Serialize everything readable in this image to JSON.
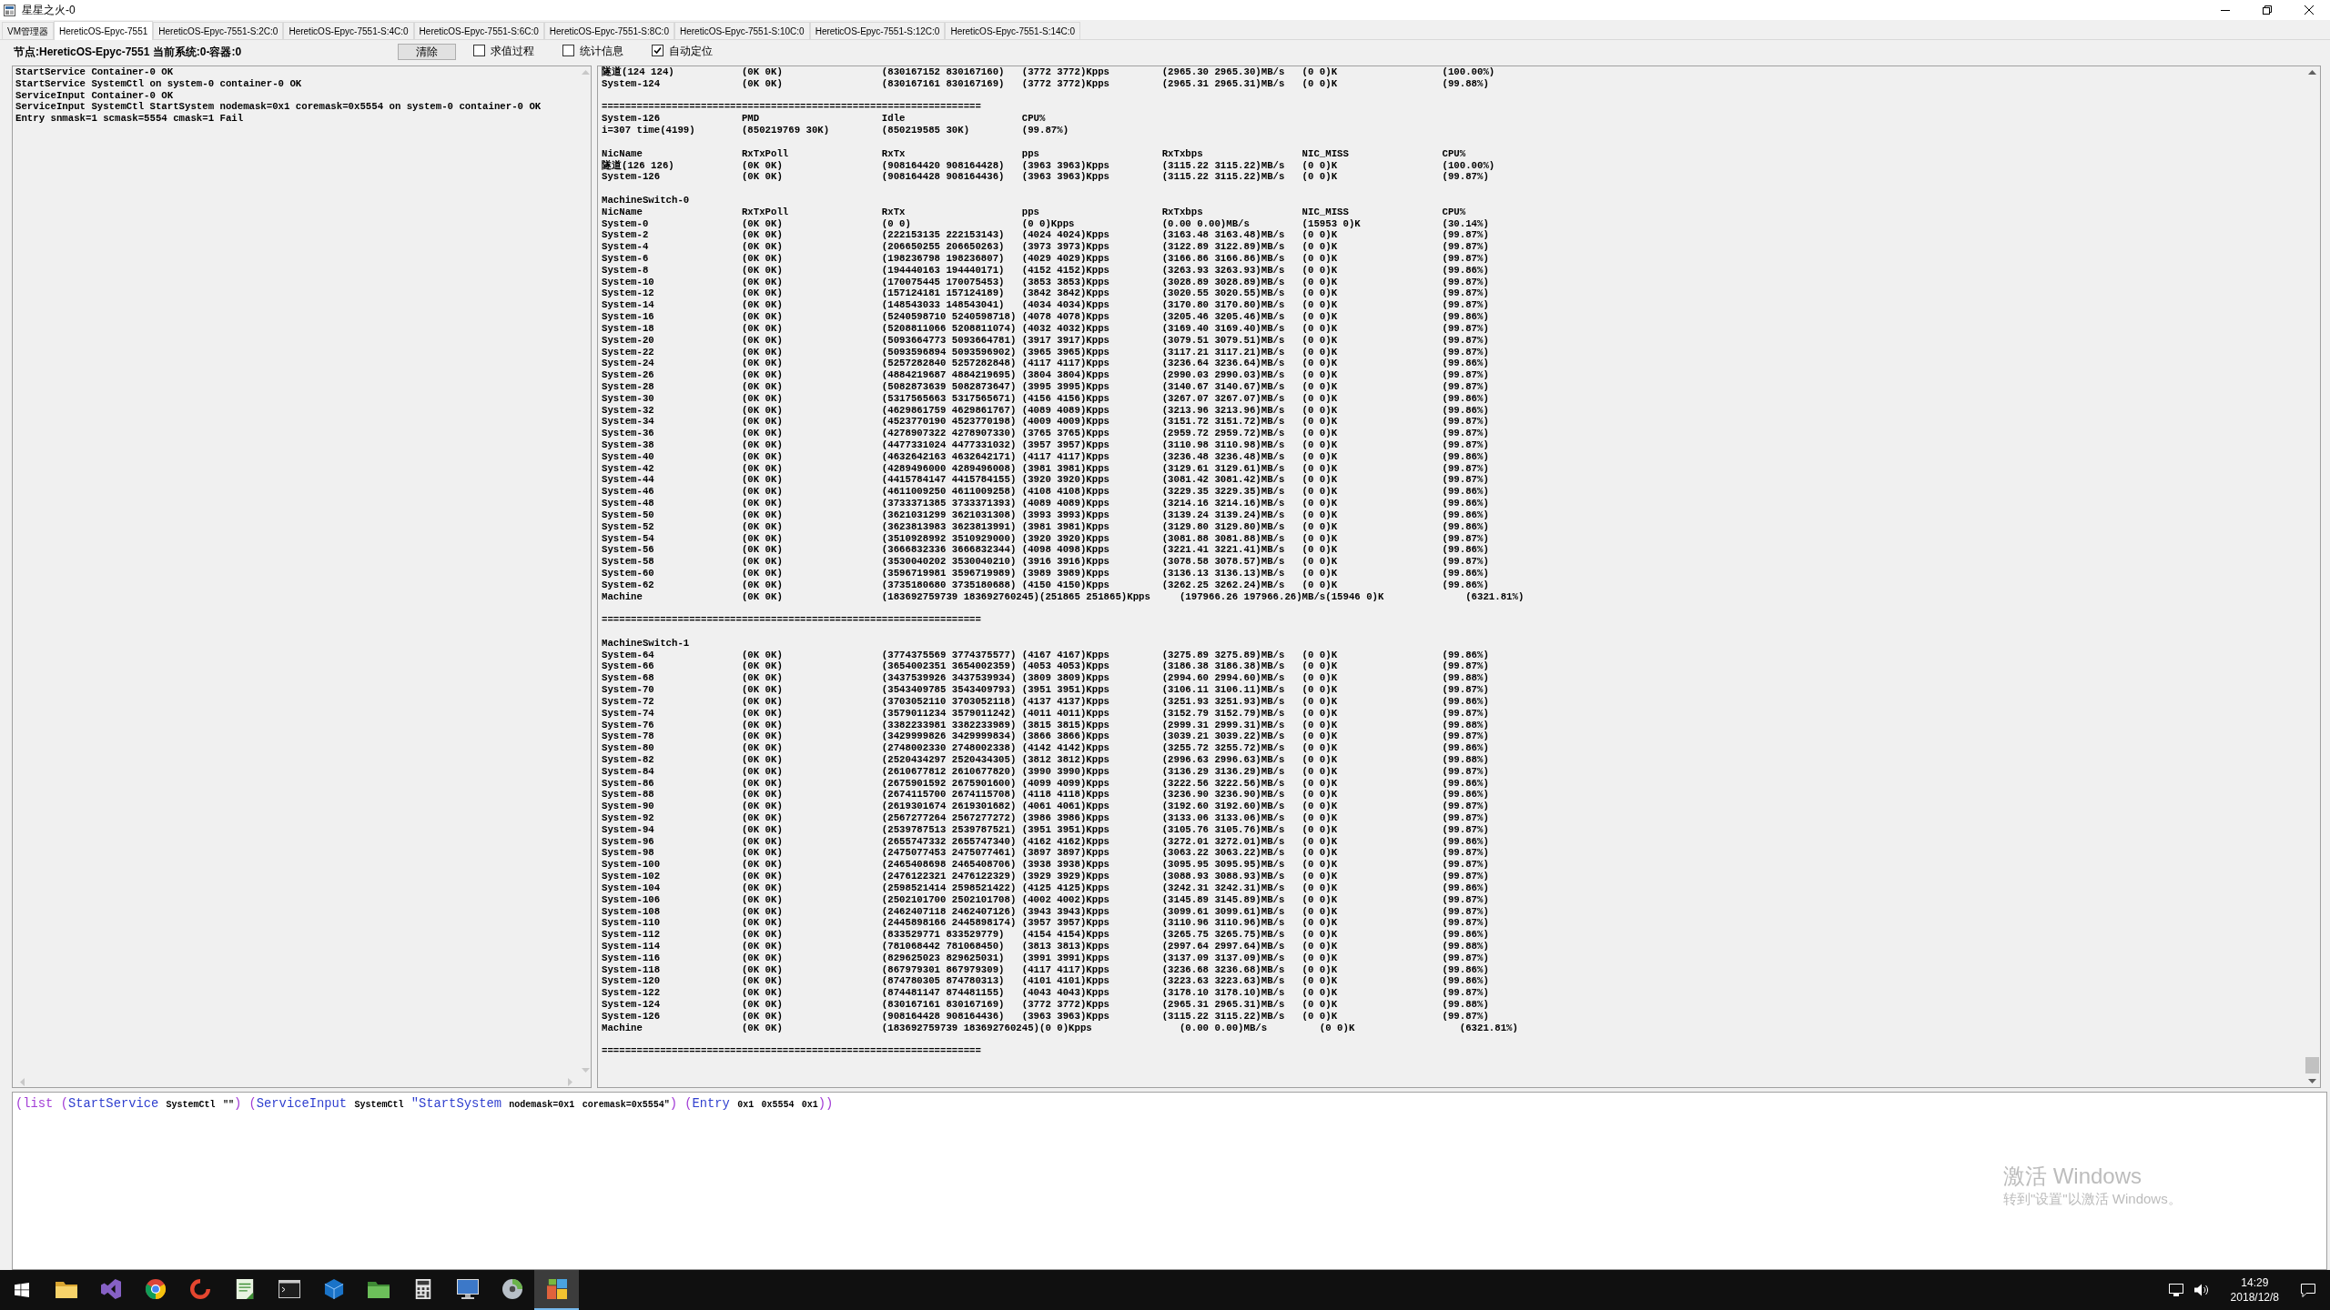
{
  "window": {
    "title": "星星之火-0"
  },
  "tabs": [
    {
      "label": "VM管理器",
      "selected": false
    },
    {
      "label": "HereticOS-Epyc-7551",
      "selected": true
    },
    {
      "label": "HereticOS-Epyc-7551-S:2C:0",
      "selected": false
    },
    {
      "label": "HereticOS-Epyc-7551-S:4C:0",
      "selected": false
    },
    {
      "label": "HereticOS-Epyc-7551-S:6C:0",
      "selected": false
    },
    {
      "label": "HereticOS-Epyc-7551-S:8C:0",
      "selected": false
    },
    {
      "label": "HereticOS-Epyc-7551-S:10C:0",
      "selected": false
    },
    {
      "label": "HereticOS-Epyc-7551-S:12C:0",
      "selected": false
    },
    {
      "label": "HereticOS-Epyc-7551-S:14C:0",
      "selected": false
    }
  ],
  "toolbar": {
    "node_label": "节点:HereticOS-Epyc-7551 当前系统:0-容器:0",
    "clear_button": "清除",
    "checkboxes": [
      {
        "label": "求值过程",
        "checked": false
      },
      {
        "label": "统计信息",
        "checked": false
      },
      {
        "label": "自动定位",
        "checked": true
      }
    ]
  },
  "log_panel": {
    "lines": [
      "StartService Container-0 OK",
      "StartService SystemCtl on system-0 container-0 OK",
      "ServiceInput Container-0 OK",
      "ServiceInput SystemCtl StartSystem nodemask=0x1 coremask=0x5554 on system-0 container-0 OK",
      "Entry snmask=1 scmask=5554 cmask=1 Fail"
    ]
  },
  "stats_panel": {
    "lines": [
      {
        "kind": "row",
        "cells": [
          "隧道(124 124)",
          "(0K 0K)",
          "(830167152 830167160)",
          "(3772 3772)Kpps",
          "(2965.30 2965.30)MB/s",
          "(0 0)K",
          "(100.00%)"
        ]
      },
      {
        "kind": "row",
        "cells": [
          "System-124",
          "(0K 0K)",
          "(830167161 830167169)",
          "(3772 3772)Kpps",
          "(2965.31 2965.31)MB/s",
          "(0 0)K",
          "(99.88%)"
        ]
      },
      {
        "kind": "blank"
      },
      {
        "kind": "separator",
        "text": "================================================================="
      },
      {
        "kind": "row",
        "cells": [
          "System-126",
          "PMD",
          "Idle",
          "CPU%"
        ]
      },
      {
        "kind": "row",
        "cells": [
          "i=307 time(4199)",
          "(850219769 30K)",
          "(850219585 30K)",
          "(99.87%)"
        ]
      },
      {
        "kind": "blank"
      },
      {
        "kind": "row",
        "cells": [
          "NicName",
          "RxTxPoll",
          "RxTx",
          "pps",
          "RxTxbps",
          "NIC_MISS",
          "CPU%"
        ]
      },
      {
        "kind": "row",
        "cells": [
          "隧道(126 126)",
          "(0K 0K)",
          "(908164420 908164428)",
          "(3963 3963)Kpps",
          "(3115.22 3115.22)MB/s",
          "(0 0)K",
          "(100.00%)"
        ]
      },
      {
        "kind": "row",
        "cells": [
          "System-126",
          "(0K 0K)",
          "(908164428 908164436)",
          "(3963 3963)Kpps",
          "(3115.22 3115.22)MB/s",
          "(0 0)K",
          "(99.87%)"
        ]
      },
      {
        "kind": "blank"
      },
      {
        "kind": "row",
        "cells": [
          "MachineSwitch-0"
        ]
      },
      {
        "kind": "row",
        "cells": [
          "NicName",
          "RxTxPoll",
          "RxTx",
          "pps",
          "RxTxbps",
          "NIC_MISS",
          "CPU%"
        ]
      },
      {
        "kind": "row",
        "cells": [
          "System-0",
          "(0K 0K)",
          "(0 0)",
          "(0 0)Kpps",
          "(0.00 0.00)MB/s",
          "(15953 0)K",
          "(30.14%)"
        ]
      },
      {
        "kind": "row",
        "cells": [
          "System-2",
          "(0K 0K)",
          "(222153135 222153143)",
          "(4024 4024)Kpps",
          "(3163.48 3163.48)MB/s",
          "(0 0)K",
          "(99.87%)"
        ]
      },
      {
        "kind": "row",
        "cells": [
          "System-4",
          "(0K 0K)",
          "(206650255 206650263)",
          "(3973 3973)Kpps",
          "(3122.89 3122.89)MB/s",
          "(0 0)K",
          "(99.87%)"
        ]
      },
      {
        "kind": "row",
        "cells": [
          "System-6",
          "(0K 0K)",
          "(198236798 198236807)",
          "(4029 4029)Kpps",
          "(3166.86 3166.86)MB/s",
          "(0 0)K",
          "(99.87%)"
        ]
      },
      {
        "kind": "row",
        "cells": [
          "System-8",
          "(0K 0K)",
          "(194440163 194440171)",
          "(4152 4152)Kpps",
          "(3263.93 3263.93)MB/s",
          "(0 0)K",
          "(99.86%)"
        ]
      },
      {
        "kind": "row",
        "cells": [
          "System-10",
          "(0K 0K)",
          "(170075445 170075453)",
          "(3853 3853)Kpps",
          "(3028.89 3028.89)MB/s",
          "(0 0)K",
          "(99.87%)"
        ]
      },
      {
        "kind": "row",
        "cells": [
          "System-12",
          "(0K 0K)",
          "(157124181 157124189)",
          "(3842 3842)Kpps",
          "(3020.55 3020.55)MB/s",
          "(0 0)K",
          "(99.87%)"
        ]
      },
      {
        "kind": "row",
        "cells": [
          "System-14",
          "(0K 0K)",
          "(148543033 148543041)",
          "(4034 4034)Kpps",
          "(3170.80 3170.80)MB/s",
          "(0 0)K",
          "(99.87%)"
        ]
      },
      {
        "kind": "row",
        "cells": [
          "System-16",
          "(0K 0K)",
          "(5240598710 5240598718)",
          "(4078 4078)Kpps",
          "(3205.46 3205.46)MB/s",
          "(0 0)K",
          "(99.86%)"
        ]
      },
      {
        "kind": "row",
        "cells": [
          "System-18",
          "(0K 0K)",
          "(5208811066 5208811074)",
          "(4032 4032)Kpps",
          "(3169.40 3169.40)MB/s",
          "(0 0)K",
          "(99.87%)"
        ]
      },
      {
        "kind": "row",
        "cells": [
          "System-20",
          "(0K 0K)",
          "(5093664773 5093664781)",
          "(3917 3917)Kpps",
          "(3079.51 3079.51)MB/s",
          "(0 0)K",
          "(99.87%)"
        ]
      },
      {
        "kind": "row",
        "cells": [
          "System-22",
          "(0K 0K)",
          "(5093596894 5093596902)",
          "(3965 3965)Kpps",
          "(3117.21 3117.21)MB/s",
          "(0 0)K",
          "(99.87%)"
        ]
      },
      {
        "kind": "row",
        "cells": [
          "System-24",
          "(0K 0K)",
          "(5257282840 5257282848)",
          "(4117 4117)Kpps",
          "(3236.64 3236.64)MB/s",
          "(0 0)K",
          "(99.86%)"
        ]
      },
      {
        "kind": "row",
        "cells": [
          "System-26",
          "(0K 0K)",
          "(4884219687 4884219695)",
          "(3804 3804)Kpps",
          "(2990.03 2990.03)MB/s",
          "(0 0)K",
          "(99.87%)"
        ]
      },
      {
        "kind": "row",
        "cells": [
          "System-28",
          "(0K 0K)",
          "(5082873639 5082873647)",
          "(3995 3995)Kpps",
          "(3140.67 3140.67)MB/s",
          "(0 0)K",
          "(99.87%)"
        ]
      },
      {
        "kind": "row",
        "cells": [
          "System-30",
          "(0K 0K)",
          "(5317565663 5317565671)",
          "(4156 4156)Kpps",
          "(3267.07 3267.07)MB/s",
          "(0 0)K",
          "(99.86%)"
        ]
      },
      {
        "kind": "row",
        "cells": [
          "System-32",
          "(0K 0K)",
          "(4629861759 4629861767)",
          "(4089 4089)Kpps",
          "(3213.96 3213.96)MB/s",
          "(0 0)K",
          "(99.86%)"
        ]
      },
      {
        "kind": "row",
        "cells": [
          "System-34",
          "(0K 0K)",
          "(4523770190 4523770198)",
          "(4009 4009)Kpps",
          "(3151.72 3151.72)MB/s",
          "(0 0)K",
          "(99.87%)"
        ]
      },
      {
        "kind": "row",
        "cells": [
          "System-36",
          "(0K 0K)",
          "(4278907322 4278907330)",
          "(3765 3765)Kpps",
          "(2959.72 2959.72)MB/s",
          "(0 0)K",
          "(99.87%)"
        ]
      },
      {
        "kind": "row",
        "cells": [
          "System-38",
          "(0K 0K)",
          "(4477331024 4477331032)",
          "(3957 3957)Kpps",
          "(3110.98 3110.98)MB/s",
          "(0 0)K",
          "(99.87%)"
        ]
      },
      {
        "kind": "row",
        "cells": [
          "System-40",
          "(0K 0K)",
          "(4632642163 4632642171)",
          "(4117 4117)Kpps",
          "(3236.48 3236.48)MB/s",
          "(0 0)K",
          "(99.86%)"
        ]
      },
      {
        "kind": "row",
        "cells": [
          "System-42",
          "(0K 0K)",
          "(4289496000 4289496008)",
          "(3981 3981)Kpps",
          "(3129.61 3129.61)MB/s",
          "(0 0)K",
          "(99.87%)"
        ]
      },
      {
        "kind": "row",
        "cells": [
          "System-44",
          "(0K 0K)",
          "(4415784147 4415784155)",
          "(3920 3920)Kpps",
          "(3081.42 3081.42)MB/s",
          "(0 0)K",
          "(99.87%)"
        ]
      },
      {
        "kind": "row",
        "cells": [
          "System-46",
          "(0K 0K)",
          "(4611009250 4611009258)",
          "(4108 4108)Kpps",
          "(3229.35 3229.35)MB/s",
          "(0 0)K",
          "(99.86%)"
        ]
      },
      {
        "kind": "row",
        "cells": [
          "System-48",
          "(0K 0K)",
          "(3733371385 3733371393)",
          "(4089 4089)Kpps",
          "(3214.16 3214.16)MB/s",
          "(0 0)K",
          "(99.86%)"
        ]
      },
      {
        "kind": "row",
        "cells": [
          "System-50",
          "(0K 0K)",
          "(3621031299 3621031308)",
          "(3993 3993)Kpps",
          "(3139.24 3139.24)MB/s",
          "(0 0)K",
          "(99.86%)"
        ]
      },
      {
        "kind": "row",
        "cells": [
          "System-52",
          "(0K 0K)",
          "(3623813983 3623813991)",
          "(3981 3981)Kpps",
          "(3129.80 3129.80)MB/s",
          "(0 0)K",
          "(99.86%)"
        ]
      },
      {
        "kind": "row",
        "cells": [
          "System-54",
          "(0K 0K)",
          "(3510928992 3510929000)",
          "(3920 3920)Kpps",
          "(3081.88 3081.88)MB/s",
          "(0 0)K",
          "(99.87%)"
        ]
      },
      {
        "kind": "row",
        "cells": [
          "System-56",
          "(0K 0K)",
          "(3666832336 3666832344)",
          "(4098 4098)Kpps",
          "(3221.41 3221.41)MB/s",
          "(0 0)K",
          "(99.86%)"
        ]
      },
      {
        "kind": "row",
        "cells": [
          "System-58",
          "(0K 0K)",
          "(3530040202 3530040210)",
          "(3916 3916)Kpps",
          "(3078.58 3078.57)MB/s",
          "(0 0)K",
          "(99.87%)"
        ]
      },
      {
        "kind": "row",
        "cells": [
          "System-60",
          "(0K 0K)",
          "(3596719981 3596719989)",
          "(3989 3989)Kpps",
          "(3136.13 3136.13)MB/s",
          "(0 0)K",
          "(99.86%)"
        ]
      },
      {
        "kind": "row",
        "cells": [
          "System-62",
          "(0K 0K)",
          "(3735180680 3735180688)",
          "(4150 4150)Kpps",
          "(3262.25 3262.24)MB/s",
          "(0 0)K",
          "(99.86%)"
        ]
      },
      {
        "kind": "row",
        "cells": [
          "Machine",
          "(0K 0K)",
          "(183692759739 183692760245)",
          "(251865 251865)Kpps",
          "(197966.26 197966.26)MB/s",
          "(15946 0)K",
          "(6321.81%)"
        ]
      },
      {
        "kind": "blank"
      },
      {
        "kind": "separator",
        "text": "================================================================="
      },
      {
        "kind": "blank"
      },
      {
        "kind": "row",
        "cells": [
          "MachineSwitch-1"
        ]
      },
      {
        "kind": "row",
        "cells": [
          "System-64",
          "(0K 0K)",
          "(3774375569 3774375577)",
          "(4167 4167)Kpps",
          "(3275.89 3275.89)MB/s",
          "(0 0)K",
          "(99.86%)"
        ]
      },
      {
        "kind": "row",
        "cells": [
          "System-66",
          "(0K 0K)",
          "(3654002351 3654002359)",
          "(4053 4053)Kpps",
          "(3186.38 3186.38)MB/s",
          "(0 0)K",
          "(99.87%)"
        ]
      },
      {
        "kind": "row",
        "cells": [
          "System-68",
          "(0K 0K)",
          "(3437539926 3437539934)",
          "(3809 3809)Kpps",
          "(2994.60 2994.60)MB/s",
          "(0 0)K",
          "(99.88%)"
        ]
      },
      {
        "kind": "row",
        "cells": [
          "System-70",
          "(0K 0K)",
          "(3543409785 3543409793)",
          "(3951 3951)Kpps",
          "(3106.11 3106.11)MB/s",
          "(0 0)K",
          "(99.87%)"
        ]
      },
      {
        "kind": "row",
        "cells": [
          "System-72",
          "(0K 0K)",
          "(3703052110 3703052118)",
          "(4137 4137)Kpps",
          "(3251.93 3251.93)MB/s",
          "(0 0)K",
          "(99.86%)"
        ]
      },
      {
        "kind": "row",
        "cells": [
          "System-74",
          "(0K 0K)",
          "(3579011234 3579011242)",
          "(4011 4011)Kpps",
          "(3152.79 3152.79)MB/s",
          "(0 0)K",
          "(99.87%)"
        ]
      },
      {
        "kind": "row",
        "cells": [
          "System-76",
          "(0K 0K)",
          "(3382233981 3382233989)",
          "(3815 3815)Kpps",
          "(2999.31 2999.31)MB/s",
          "(0 0)K",
          "(99.88%)"
        ]
      },
      {
        "kind": "row",
        "cells": [
          "System-78",
          "(0K 0K)",
          "(3429999826 3429999834)",
          "(3866 3866)Kpps",
          "(3039.21 3039.22)MB/s",
          "(0 0)K",
          "(99.87%)"
        ]
      },
      {
        "kind": "row",
        "cells": [
          "System-80",
          "(0K 0K)",
          "(2748002330 2748002338)",
          "(4142 4142)Kpps",
          "(3255.72 3255.72)MB/s",
          "(0 0)K",
          "(99.86%)"
        ]
      },
      {
        "kind": "row",
        "cells": [
          "System-82",
          "(0K 0K)",
          "(2520434297 2520434305)",
          "(3812 3812)Kpps",
          "(2996.63 2996.63)MB/s",
          "(0 0)K",
          "(99.88%)"
        ]
      },
      {
        "kind": "row",
        "cells": [
          "System-84",
          "(0K 0K)",
          "(2610677812 2610677820)",
          "(3990 3990)Kpps",
          "(3136.29 3136.29)MB/s",
          "(0 0)K",
          "(99.87%)"
        ]
      },
      {
        "kind": "row",
        "cells": [
          "System-86",
          "(0K 0K)",
          "(2675901592 2675901600)",
          "(4099 4099)Kpps",
          "(3222.56 3222.56)MB/s",
          "(0 0)K",
          "(99.86%)"
        ]
      },
      {
        "kind": "row",
        "cells": [
          "System-88",
          "(0K 0K)",
          "(2674115700 2674115708)",
          "(4118 4118)Kpps",
          "(3236.90 3236.90)MB/s",
          "(0 0)K",
          "(99.86%)"
        ]
      },
      {
        "kind": "row",
        "cells": [
          "System-90",
          "(0K 0K)",
          "(2619301674 2619301682)",
          "(4061 4061)Kpps",
          "(3192.60 3192.60)MB/s",
          "(0 0)K",
          "(99.87%)"
        ]
      },
      {
        "kind": "row",
        "cells": [
          "System-92",
          "(0K 0K)",
          "(2567277264 2567277272)",
          "(3986 3986)Kpps",
          "(3133.06 3133.06)MB/s",
          "(0 0)K",
          "(99.87%)"
        ]
      },
      {
        "kind": "row",
        "cells": [
          "System-94",
          "(0K 0K)",
          "(2539787513 2539787521)",
          "(3951 3951)Kpps",
          "(3105.76 3105.76)MB/s",
          "(0 0)K",
          "(99.87%)"
        ]
      },
      {
        "kind": "row",
        "cells": [
          "System-96",
          "(0K 0K)",
          "(2655747332 2655747340)",
          "(4162 4162)Kpps",
          "(3272.01 3272.01)MB/s",
          "(0 0)K",
          "(99.86%)"
        ]
      },
      {
        "kind": "row",
        "cells": [
          "System-98",
          "(0K 0K)",
          "(2475077453 2475077461)",
          "(3897 3897)Kpps",
          "(3063.22 3063.22)MB/s",
          "(0 0)K",
          "(99.87%)"
        ]
      },
      {
        "kind": "row",
        "cells": [
          "System-100",
          "(0K 0K)",
          "(2465408698 2465408706)",
          "(3938 3938)Kpps",
          "(3095.95 3095.95)MB/s",
          "(0 0)K",
          "(99.87%)"
        ]
      },
      {
        "kind": "row",
        "cells": [
          "System-102",
          "(0K 0K)",
          "(2476122321 2476122329)",
          "(3929 3929)Kpps",
          "(3088.93 3088.93)MB/s",
          "(0 0)K",
          "(99.87%)"
        ]
      },
      {
        "kind": "row",
        "cells": [
          "System-104",
          "(0K 0K)",
          "(2598521414 2598521422)",
          "(4125 4125)Kpps",
          "(3242.31 3242.31)MB/s",
          "(0 0)K",
          "(99.86%)"
        ]
      },
      {
        "kind": "row",
        "cells": [
          "System-106",
          "(0K 0K)",
          "(2502101700 2502101708)",
          "(4002 4002)Kpps",
          "(3145.89 3145.89)MB/s",
          "(0 0)K",
          "(99.87%)"
        ]
      },
      {
        "kind": "row",
        "cells": [
          "System-108",
          "(0K 0K)",
          "(2462407118 2462407126)",
          "(3943 3943)Kpps",
          "(3099.61 3099.61)MB/s",
          "(0 0)K",
          "(99.87%)"
        ]
      },
      {
        "kind": "row",
        "cells": [
          "System-110",
          "(0K 0K)",
          "(2445898166 2445898174)",
          "(3957 3957)Kpps",
          "(3110.96 3110.96)MB/s",
          "(0 0)K",
          "(99.87%)"
        ]
      },
      {
        "kind": "row",
        "cells": [
          "System-112",
          "(0K 0K)",
          "(833529771 833529779)",
          "(4154 4154)Kpps",
          "(3265.75 3265.75)MB/s",
          "(0 0)K",
          "(99.86%)"
        ]
      },
      {
        "kind": "row",
        "cells": [
          "System-114",
          "(0K 0K)",
          "(781068442 781068450)",
          "(3813 3813)Kpps",
          "(2997.64 2997.64)MB/s",
          "(0 0)K",
          "(99.88%)"
        ]
      },
      {
        "kind": "row",
        "cells": [
          "System-116",
          "(0K 0K)",
          "(829625023 829625031)",
          "(3991 3991)Kpps",
          "(3137.09 3137.09)MB/s",
          "(0 0)K",
          "(99.87%)"
        ]
      },
      {
        "kind": "row",
        "cells": [
          "System-118",
          "(0K 0K)",
          "(867979301 867979309)",
          "(4117 4117)Kpps",
          "(3236.68 3236.68)MB/s",
          "(0 0)K",
          "(99.86%)"
        ]
      },
      {
        "kind": "row",
        "cells": [
          "System-120",
          "(0K 0K)",
          "(874780305 874780313)",
          "(4101 4101)Kpps",
          "(3223.63 3223.63)MB/s",
          "(0 0)K",
          "(99.86%)"
        ]
      },
      {
        "kind": "row",
        "cells": [
          "System-122",
          "(0K 0K)",
          "(874481147 874481155)",
          "(4043 4043)Kpps",
          "(3178.10 3178.10)MB/s",
          "(0 0)K",
          "(99.87%)"
        ]
      },
      {
        "kind": "row",
        "cells": [
          "System-124",
          "(0K 0K)",
          "(830167161 830167169)",
          "(3772 3772)Kpps",
          "(2965.31 2965.31)MB/s",
          "(0 0)K",
          "(99.88%)"
        ]
      },
      {
        "kind": "row",
        "cells": [
          "System-126",
          "(0K 0K)",
          "(908164428 908164436)",
          "(3963 3963)Kpps",
          "(3115.22 3115.22)MB/s",
          "(0 0)K",
          "(99.87%)"
        ]
      },
      {
        "kind": "row",
        "cells": [
          "Machine",
          "(0K 0K)",
          "(183692759739 183692760245)",
          "(0 0)Kpps",
          "(0.00 0.00)MB/s",
          "(0 0)K",
          "(6321.81%)"
        ]
      },
      {
        "kind": "blank"
      },
      {
        "kind": "separator",
        "text": "================================================================="
      }
    ]
  },
  "command_bar": {
    "tokens": [
      {
        "kind": "open",
        "text": "("
      },
      {
        "kind": "builtin",
        "text": "list"
      },
      {
        "kind": "open",
        "text": "("
      },
      {
        "kind": "function",
        "text": "StartService"
      },
      {
        "kind": "arg",
        "text": "SystemCtl"
      },
      {
        "kind": "arg",
        "text": "\"\""
      },
      {
        "kind": "close",
        "text": ")"
      },
      {
        "kind": "open",
        "text": "("
      },
      {
        "kind": "function",
        "text": "ServiceInput"
      },
      {
        "kind": "arg",
        "text": "SystemCtl"
      },
      {
        "kind": "function",
        "text": "\"StartSystem"
      },
      {
        "kind": "arg",
        "text": "nodemask=0x1"
      },
      {
        "kind": "arg",
        "text": "coremask=0x5554\""
      },
      {
        "kind": "close",
        "text": ")"
      },
      {
        "kind": "open",
        "text": "("
      },
      {
        "kind": "function",
        "text": "Entry"
      },
      {
        "kind": "arg",
        "text": "0x1"
      },
      {
        "kind": "arg",
        "text": "0x5554"
      },
      {
        "kind": "arg",
        "text": "0x1"
      },
      {
        "kind": "close",
        "text": ")"
      },
      {
        "kind": "close",
        "text": ")"
      }
    ]
  },
  "activation_notice": {
    "title": "激活 Windows",
    "subtitle": "转到\"设置\"以激活 Windows。"
  },
  "taskbar": {
    "apps": [
      {
        "selected": false
      },
      {
        "selected": false
      },
      {
        "selected": false
      },
      {
        "selected": false
      },
      {
        "selected": false
      },
      {
        "selected": false
      },
      {
        "selected": false
      },
      {
        "selected": false
      },
      {
        "selected": false
      },
      {
        "selected": false
      },
      {
        "selected": false
      },
      {
        "selected": true
      }
    ],
    "time": "14:29",
    "date": "2018/12/8"
  }
}
